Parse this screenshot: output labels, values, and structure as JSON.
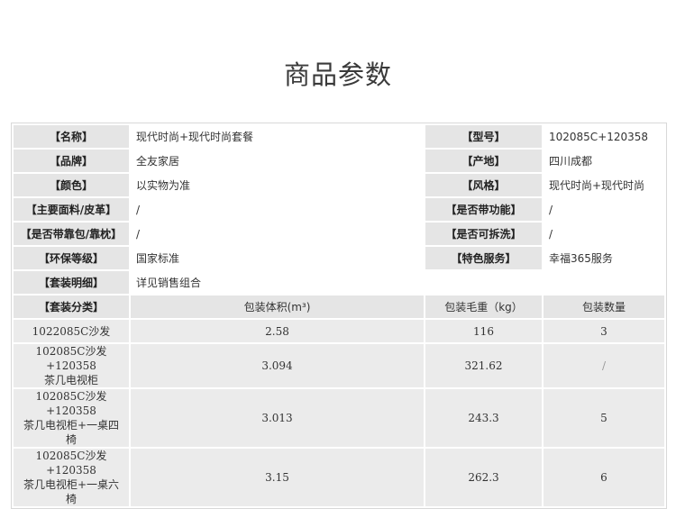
{
  "page": {
    "title": "商品参数"
  },
  "params": [
    [
      {
        "label": "【名称】",
        "value": "现代时尚+现代时尚套餐"
      },
      {
        "label": "【型号】",
        "value": "102085C+120358"
      }
    ],
    [
      {
        "label": "【品牌】",
        "value": "全友家居"
      },
      {
        "label": "【产地】",
        "value": "四川成都"
      }
    ],
    [
      {
        "label": "【颜色】",
        "value": "以实物为准"
      },
      {
        "label": "【风格】",
        "value": "现代时尚+现代时尚"
      }
    ],
    [
      {
        "label": "【主要面料/皮革】",
        "value": "/"
      },
      {
        "label": "【是否带功能】",
        "value": "/"
      }
    ],
    [
      {
        "label": "【是否带靠包/靠枕】",
        "value": "/"
      },
      {
        "label": "【是否可拆洗】",
        "value": "/"
      }
    ],
    [
      {
        "label": "【环保等级】",
        "value": "国家标准"
      },
      {
        "label": "【特色服务】",
        "value": "幸福365服务"
      }
    ]
  ],
  "set_detail": {
    "label": "【套装明细】",
    "value": "详见销售组合"
  },
  "set_table": {
    "headers": [
      "【套装分类】",
      "包装体积(m³)",
      "包装毛重（kg）",
      "包装数量"
    ],
    "rows": [
      {
        "name_line1": "1022085C沙发",
        "name_line2": "",
        "volume": "2.58",
        "weight": "116",
        "qty": "3"
      },
      {
        "name_line1": "102085C沙发+120358",
        "name_line2": "茶几电视柜",
        "volume": "3.094",
        "weight": "321.62",
        "qty": "/"
      },
      {
        "name_line1": "102085C沙发+120358",
        "name_line2": "茶几电视柜+一桌四椅",
        "volume": "3.013",
        "weight": "243.3",
        "qty": "5"
      },
      {
        "name_line1": "102085C沙发+120358",
        "name_line2": "茶几电视柜+一桌六椅",
        "volume": "3.15",
        "weight": "262.3",
        "qty": "6"
      }
    ]
  }
}
